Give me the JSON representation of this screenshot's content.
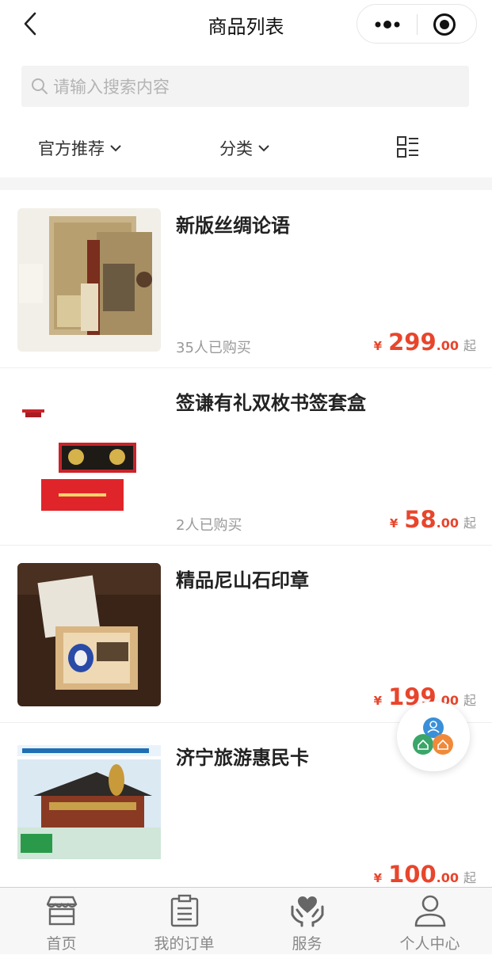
{
  "header": {
    "title": "商品列表"
  },
  "search": {
    "placeholder": "请输入搜索内容"
  },
  "filters": [
    {
      "label": "官方推荐"
    },
    {
      "label": "分类"
    }
  ],
  "products": [
    {
      "name": "新版丝绸论语",
      "sold": "35人已购买",
      "currency": "¥",
      "price_int": "299",
      "price_dec": ".00",
      "suffix": "起"
    },
    {
      "name": "签谦有礼双枚书签套盒",
      "sold": "2人已购买",
      "currency": "¥",
      "price_int": "58",
      "price_dec": ".00",
      "suffix": "起"
    },
    {
      "name": "精品尼山石印章",
      "sold": "",
      "currency": "¥",
      "price_int": "199",
      "price_dec": ".00",
      "suffix": "起"
    },
    {
      "name": "济宁旅游惠民卡",
      "sold": "",
      "currency": "¥",
      "price_int": "100",
      "price_dec": ".00",
      "suffix": "起"
    }
  ],
  "tabbar": [
    {
      "label": "首页",
      "icon": "store-icon"
    },
    {
      "label": "我的订单",
      "icon": "order-list-icon"
    },
    {
      "label": "服务",
      "icon": "heart-hands-icon"
    },
    {
      "label": "个人中心",
      "icon": "person-icon"
    }
  ],
  "colors": {
    "price": "#e8452c",
    "muted": "#999999",
    "search_bg": "#f3f3f3"
  }
}
